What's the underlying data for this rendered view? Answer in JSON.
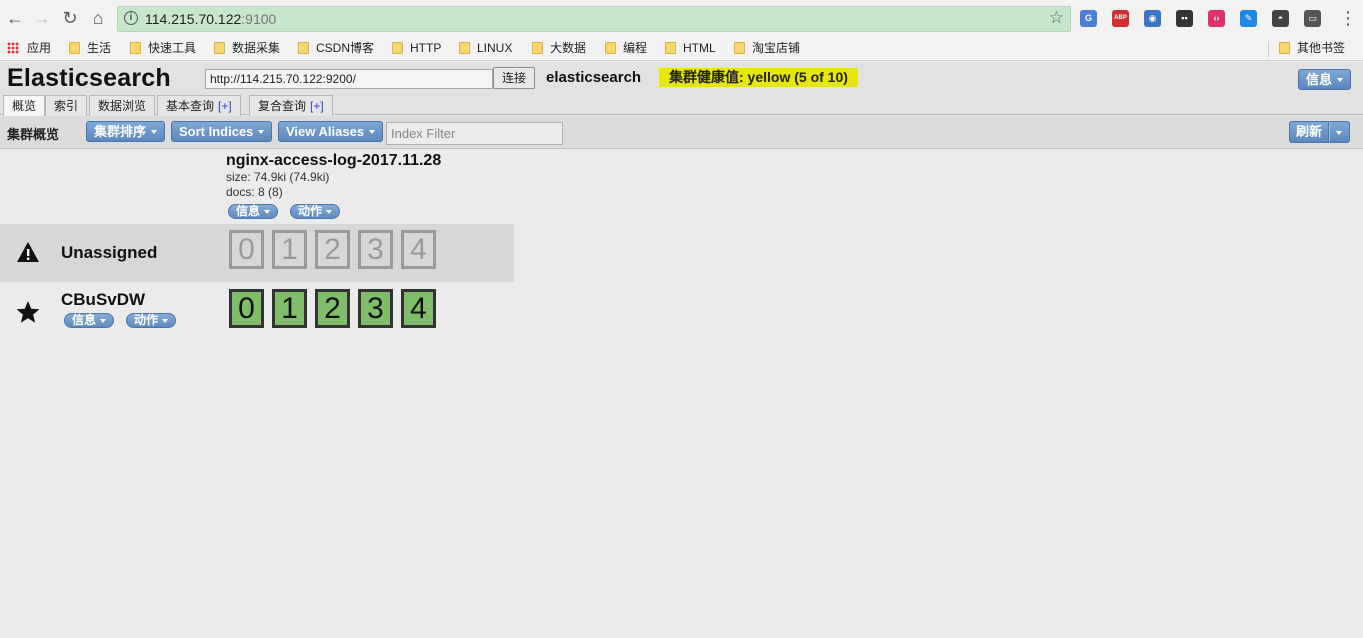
{
  "browser": {
    "url_host": "114.215.70.122",
    "url_port": ":9100",
    "bookmarks": [
      "应用",
      "生活",
      "快速工具",
      "数据采集",
      "CSDN博客",
      "HTTP",
      "LINUX",
      "大数据",
      "编程",
      "HTML",
      "淘宝店铺",
      "其他书签"
    ],
    "extensions": [
      {
        "name": "translate-extension-icon",
        "color": "#4a7fd6",
        "glyph": "G"
      },
      {
        "name": "adblock-extension-icon",
        "color": "#d32f2f",
        "glyph": "ABP"
      },
      {
        "name": "globe-extension-icon",
        "color": "#3a74c4",
        "glyph": "◉"
      },
      {
        "name": "tampermonkey-extension-icon",
        "color": "#333333",
        "glyph": "▪▪"
      },
      {
        "name": "pin-extension-icon",
        "color": "#e0306a",
        "glyph": "‹›"
      },
      {
        "name": "pen-extension-icon",
        "color": "#1e88e5",
        "glyph": "✎"
      },
      {
        "name": "incognito-extension-icon",
        "color": "#444444",
        "glyph": "◓"
      },
      {
        "name": "monitor-extension-icon",
        "color": "#555555",
        "glyph": "▭"
      }
    ]
  },
  "header": {
    "title": "Elasticsearch",
    "connect_url": "http://114.215.70.122:9200/",
    "connect_label": "连接",
    "cluster_name": "elasticsearch",
    "health": "集群健康值: yellow (5 of 10)",
    "info_label": "信息"
  },
  "tabs": [
    {
      "label": "概览",
      "plus": ""
    },
    {
      "label": "索引",
      "plus": ""
    },
    {
      "label": "数据浏览",
      "plus": ""
    },
    {
      "label": "基本查询",
      "plus": "[+]"
    },
    {
      "label": "复合查询",
      "plus": "[+]"
    }
  ],
  "toolbar": {
    "title": "集群概览",
    "sort_cluster": "集群排序",
    "sort_indices": "Sort Indices",
    "view_aliases": "View Aliases",
    "filter_placeholder": "Index Filter",
    "refresh": "刷新"
  },
  "index": {
    "name": "nginx-access-log-2017.11.28",
    "size": "size: 74.9ki (74.9ki)",
    "docs": "docs: 8 (8)",
    "info_label": "信息",
    "action_label": "动作"
  },
  "rows": {
    "unassigned": {
      "label": "Unassigned",
      "icon": "warning-icon",
      "shards": [
        "0",
        "1",
        "2",
        "3",
        "4"
      ]
    },
    "node": {
      "label": "CBuSvDW",
      "icon": "star-icon",
      "info_label": "信息",
      "action_label": "动作",
      "shards": [
        "0",
        "1",
        "2",
        "3",
        "4"
      ]
    }
  },
  "colors": {
    "health_yellow": "#e6e60a",
    "shard_started": "#7fbd6a",
    "shard_unassigned": "#9a9a9a",
    "button_blue": "#5c87bd"
  }
}
